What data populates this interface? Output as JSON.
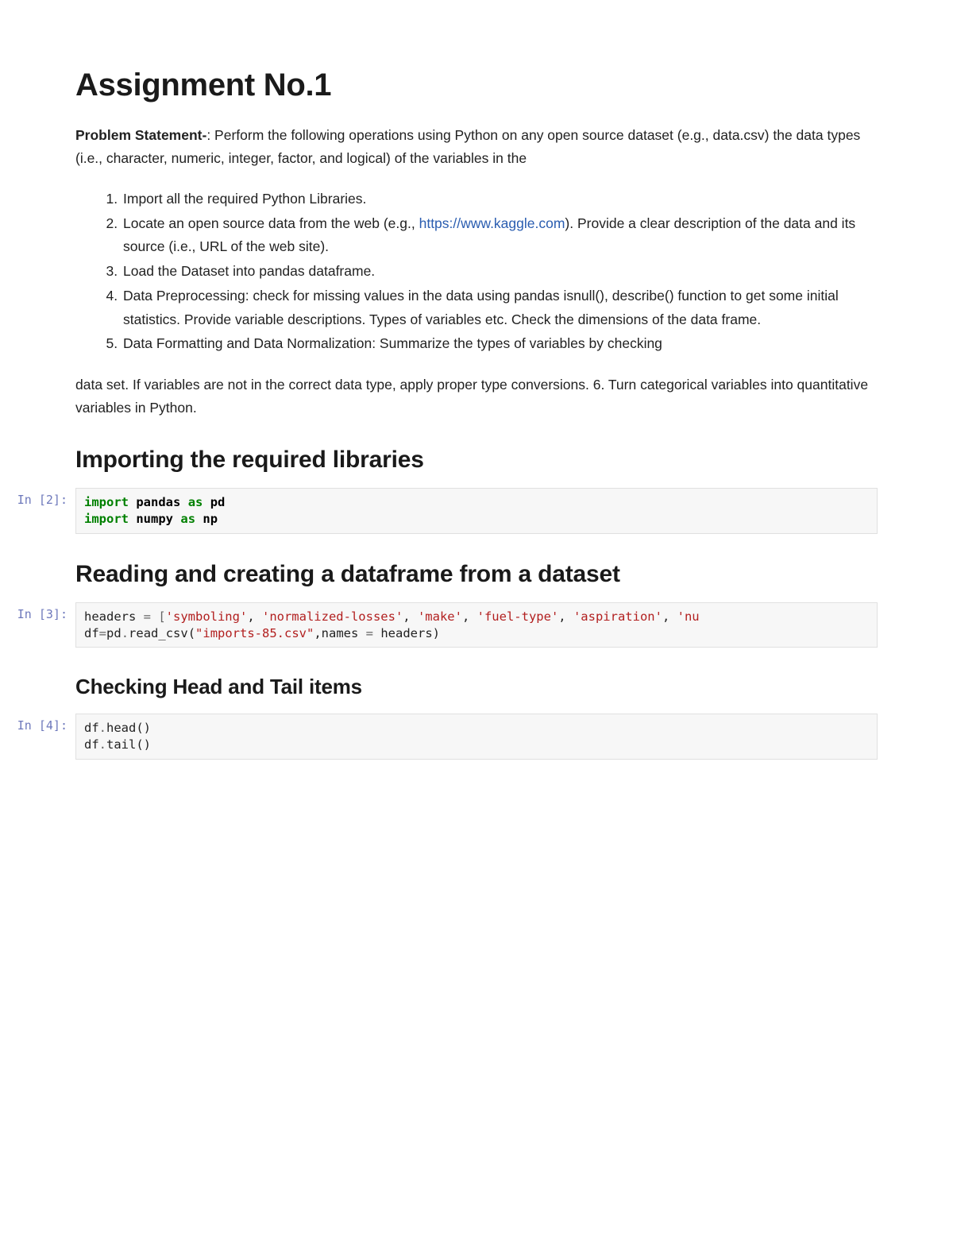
{
  "title": "Assignment No.1",
  "intro": {
    "bold": "Problem Statement-",
    "text": ": Perform the following operations using Python on any open source dataset (e.g., data.csv) the data types (i.e., character, numeric, integer, factor, and logical) of the variables in the"
  },
  "steps": [
    "Import all the required Python Libraries.",
    {
      "pre": "Locate an open source data from the web (e.g., ",
      "link_text": "https://www.kaggle.com",
      "link_href": "https://www.kaggle.com",
      "post": "). Provide a clear description of the data and its source (i.e., URL of the web site)."
    },
    "Load the Dataset into pandas dataframe.",
    "Data Preprocessing: check for missing values in the data using pandas isnull(), describe() function to get some initial statistics. Provide variable descriptions. Types of variables etc. Check the dimensions of the data frame.",
    "Data Formatting and Data Normalization: Summarize the types of variables by checking"
  ],
  "trailing_para": "data set. If variables are not in the correct data type, apply proper type conversions. 6. Turn categorical variables into quantitative variables in Python.",
  "sections": {
    "import": "Importing the required libraries",
    "read": "Reading and creating a dataframe from a dataset",
    "headtail": "Checking Head and Tail items"
  },
  "cells": {
    "c2": {
      "prompt": "In [2]:",
      "code": {
        "kw_import1": "import",
        "mod1": "pandas",
        "kw_as1": "as",
        "alias1": "pd",
        "kw_import2": "import",
        "mod2": "numpy",
        "kw_as2": "as",
        "alias2": "np"
      }
    },
    "c3": {
      "prompt": "In [3]:",
      "code": {
        "var": "headers",
        "eq": " = [",
        "s1": "'symboling'",
        "s2": "'normalized-losses'",
        "s3": "'make'",
        "s4": "'fuel-type'",
        "s5": "'aspiration'",
        "s6": "'nu",
        "line2a": "df",
        "line2b": "=",
        "line2c": "pd",
        "line2d": ".",
        "fn": "read_csv",
        "paren_open": "(",
        "arg1": "\"imports-85.csv\"",
        "comma": ",names ",
        "eq2": "=",
        "arg2": " headers)",
        "sep": ", "
      }
    },
    "c4": {
      "prompt": "In [4]:",
      "code": {
        "l1a": "df",
        "l1dot": ".",
        "l1fn": "head",
        "l1p": "()",
        "l2a": "df",
        "l2dot": ".",
        "l2fn": "tail",
        "l2p": "()"
      }
    }
  }
}
